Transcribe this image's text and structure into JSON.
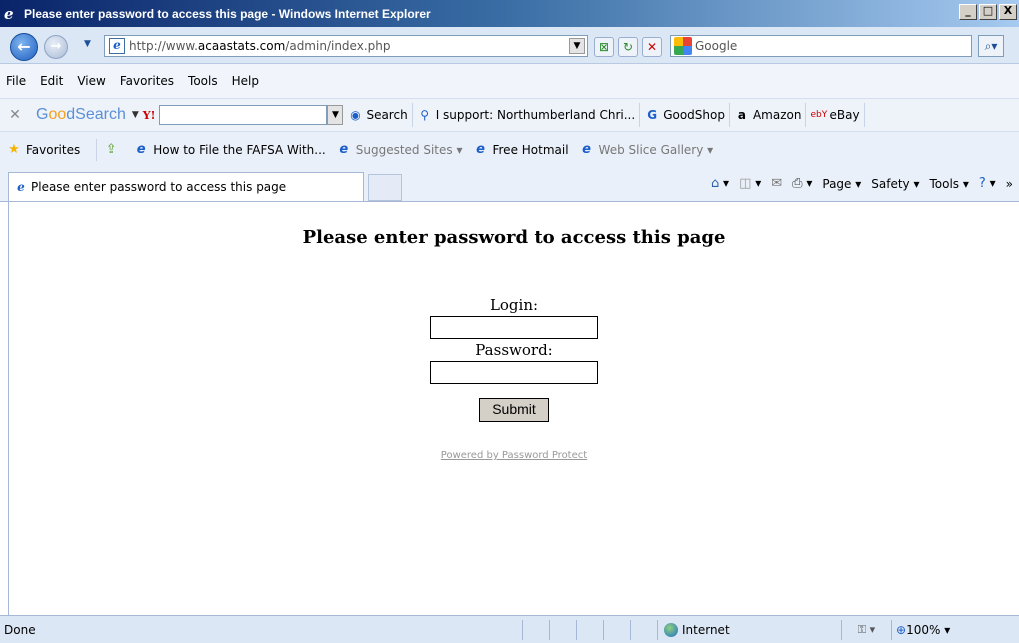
{
  "window": {
    "title": "Please enter password to access this page - Windows Internet Explorer",
    "min_label": "_",
    "max_label": "□",
    "close_label": "X"
  },
  "address": {
    "url_prefix": "http://www.",
    "url_domain": "acaastats.com",
    "url_path": "/admin/index.php",
    "search_placeholder": "Google"
  },
  "menu": [
    "File",
    "Edit",
    "View",
    "Favorites",
    "Tools",
    "Help"
  ],
  "goodsearch": {
    "logo_a": "G",
    "logo_oo": "oo",
    "logo_b": "dSearch",
    "search_label": "Search",
    "support_label": "I support: Northumberland Chri...",
    "goodshop_label": "GoodShop",
    "amazon_label": "Amazon",
    "ebay_label": "eBay"
  },
  "favorites": {
    "favorites_label": "Favorites",
    "link1": "How to File the FAFSA With...",
    "link2": "Suggested Sites ▾",
    "link3": "Free Hotmail",
    "link4": "Web Slice Gallery ▾"
  },
  "tab": {
    "label": "Please enter password to access this page"
  },
  "command": {
    "page_label": "Page ▾",
    "safety_label": "Safety ▾",
    "tools_label": "Tools ▾"
  },
  "page": {
    "heading": "Please enter password to access this page",
    "login_label": "Login:",
    "password_label": "Password:",
    "login_value": "",
    "password_value": "",
    "submit_label": "Submit",
    "powered_label": "Powered by Password Protect"
  },
  "status": {
    "text": "Done",
    "zone_label": "Internet",
    "zoom_label": "100%"
  }
}
